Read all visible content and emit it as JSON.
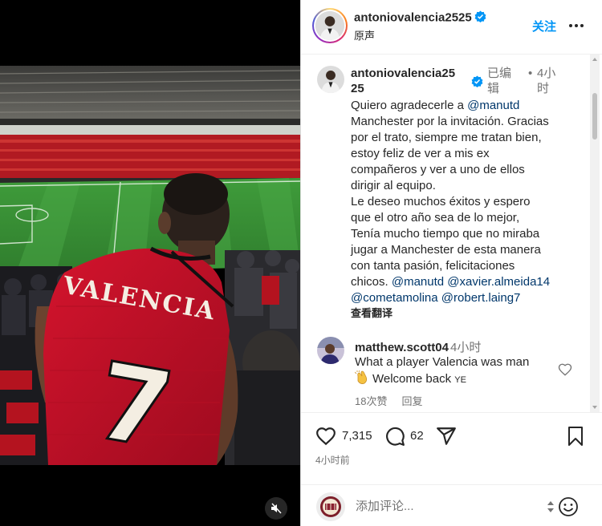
{
  "header": {
    "username": "antoniovalencia2525",
    "subtitle": "原声",
    "follow_label": "关注",
    "more_icon": "more-horizontal-icon"
  },
  "caption": {
    "username_line1": "antoniovalencia25",
    "username_line2": "25",
    "edited_line1": "已编",
    "edited_line2": "辑",
    "dot": "•",
    "time_line1": "4小",
    "time_line2": "时",
    "lines": [
      "Quiero agradecerle a",
      "Manchester por la invitación. Gracias",
      "por el trato, siempre me tratan bien,",
      "estoy feliz de ver a mis ex",
      "compañeros y ver a uno de ellos",
      "dirigir  al equipo.",
      "Le deseo muchos éxitos y espero",
      "que el otro año sea de lo mejor,",
      "Tenía mucho tiempo que no miraba",
      "jugar a Manchester de esta manera",
      "con tanta pasión, felicitaciones",
      "chicos."
    ],
    "mention_manutd_1": "@manutd",
    "mention_manutd_2": "@manutd",
    "mention_xavier": "@xavier.almeida14",
    "mention_cometa": "@cometamolina",
    "mention_robert": "@robert.laing7",
    "translate_label": "查看翻译"
  },
  "comment": {
    "username": "matthew.scott04",
    "time": "4小时",
    "line1": "What a player Valencia was man",
    "line2": "Welcome back",
    "line2_suffix": "YE",
    "likes_label": "18次赞",
    "reply_label": "回复"
  },
  "actions": {
    "likes_count": "7,315",
    "comments_count": "62",
    "posted_time": "4小时前"
  },
  "composer": {
    "placeholder": "添加评论..."
  },
  "photo": {
    "jersey_name": "VALENCIA",
    "jersey_number": "7"
  },
  "colors": {
    "accent": "#0095f6",
    "mention": "#00376b",
    "muted": "#737373",
    "jersey_red": "#c8102e"
  }
}
